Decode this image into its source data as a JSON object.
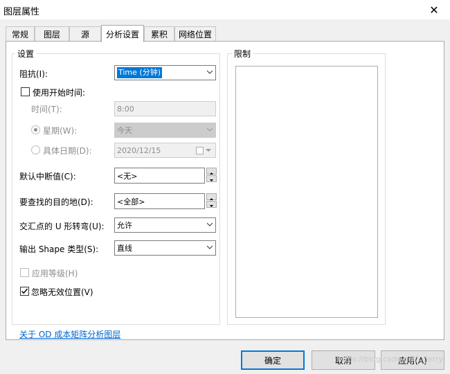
{
  "window": {
    "title": "图层属性",
    "close_glyph": "✕"
  },
  "tabs": [
    {
      "label": "常规"
    },
    {
      "label": "图层"
    },
    {
      "label": "源"
    },
    {
      "label": "分析设置"
    },
    {
      "label": "累积"
    },
    {
      "label": "网络位置"
    }
  ],
  "settings": {
    "group_title": "设置",
    "impedance": {
      "label": "阻抗(I):",
      "value": "Time (分钟)"
    },
    "use_start_time": {
      "label": "使用开始时间:",
      "checked": false
    },
    "time": {
      "label": "时间(T):",
      "value": "8:00"
    },
    "weekday": {
      "label": "星期(W):",
      "value": "今天",
      "selected": true
    },
    "specific_date": {
      "label": "具体日期(D):",
      "value": "2020/12/15",
      "selected": false
    },
    "default_cutoff": {
      "label": "默认中断值(C):",
      "value": "<无>"
    },
    "destinations": {
      "label": "要查找的目的地(D):",
      "value": "<全部>"
    },
    "uturns": {
      "label": "交汇点的 U 形转弯(U):",
      "value": "允许"
    },
    "output_shape": {
      "label": "输出 Shape 类型(S):",
      "value": "直线"
    },
    "use_hierarchy": {
      "label": "应用等级(H)",
      "checked": false
    },
    "ignore_invalid": {
      "label": "忽略无效位置(V)",
      "checked": true
    }
  },
  "restrictions": {
    "group_title": "限制"
  },
  "help_link": "关于 OD 成本矩阵分析图层",
  "buttons": {
    "ok": "确定",
    "cancel": "取消",
    "apply": "应用(A)"
  },
  "watermark": "https://blog.csdn.net/...Jerry"
}
